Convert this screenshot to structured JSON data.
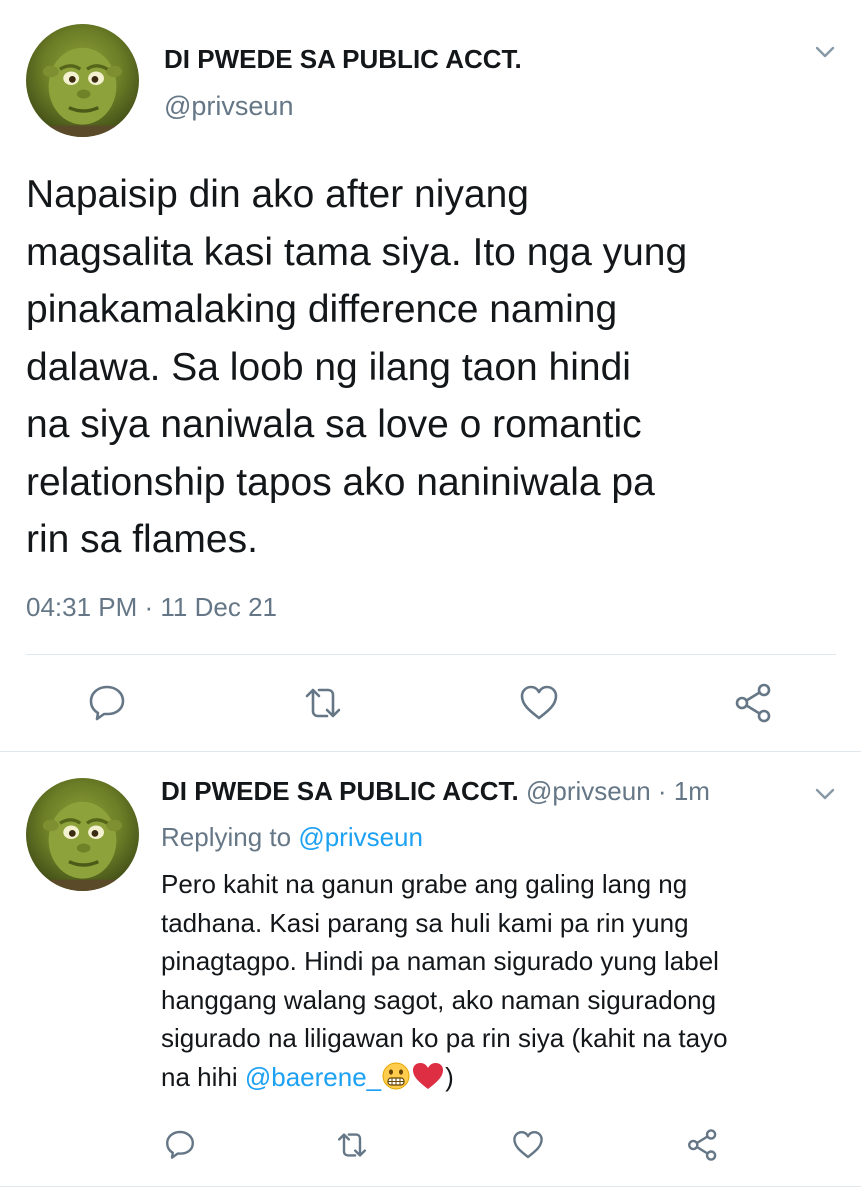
{
  "tweet": {
    "author_name": "DI PWEDE SA PUBLIC ACCT.",
    "author_handle": "@privseun",
    "text_lines": [
      "Napaisip din ako after niyang",
      "magsalita kasi tama siya. Ito nga yung",
      "pinakamalaking difference naming",
      "dalawa. Sa loob ng ilang taon hindi",
      "na siya naniwala sa love o romantic",
      "relationship tapos ako naniniwala pa",
      "rin sa flames."
    ],
    "timestamp": "04:31 PM · 11 Dec 21",
    "avatar_icon": "shrek-avatar",
    "menu_icon": "chevron-down-icon"
  },
  "reply": {
    "author_name": "DI PWEDE SA PUBLIC ACCT.",
    "author_handle": "@privseun",
    "separator": "·",
    "time_ago": "1m",
    "replying_to_prefix": "Replying to",
    "replying_to_handle": "@privseun",
    "text_lines": [
      "Pero kahit na ganun grabe ang galing lang ng",
      "tadhana. Kasi parang sa huli kami pa rin yung",
      "pinagtagpo. Hindi pa naman sigurado yung label",
      "hanggang walang sagot, ako naman siguradong",
      "sigurado na liligawan ko pa rin siya (kahit na tayo"
    ],
    "last_line_prefix": "na hihi",
    "mention": "@baerene_",
    "last_line_suffix": ")",
    "emojis": [
      "grimacing-face-emoji",
      "red-heart-emoji"
    ]
  },
  "actions": [
    "reply-icon",
    "retweet-icon",
    "like-icon",
    "share-icon"
  ],
  "colors": {
    "text": "#14171a",
    "secondary": "#657786",
    "link": "#1da1f2",
    "divider": "#e1e8ed",
    "icon": "#657786"
  }
}
